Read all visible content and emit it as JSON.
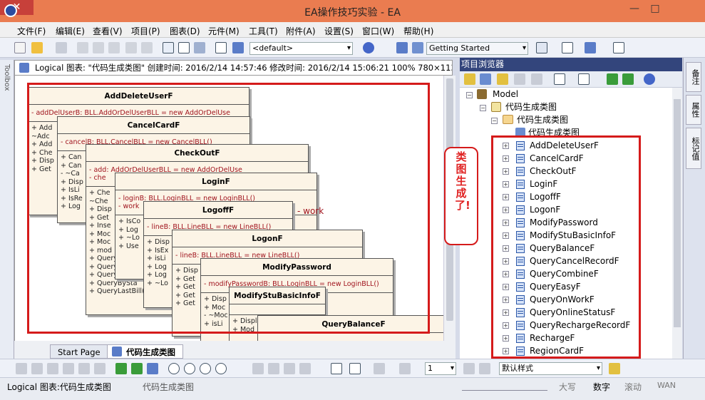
{
  "window": {
    "title": "EA操作技巧实验 - EA",
    "minimize": "—",
    "maximize": "□",
    "close": "✕"
  },
  "menu": [
    "文件(F)",
    "编辑(E)",
    "查看(V)",
    "项目(P)",
    "图表(D)",
    "元件(M)",
    "工具(T)",
    "附件(A)",
    "设置(S)",
    "窗口(W)",
    "帮助(H)"
  ],
  "toolbar": {
    "default_select": "<default>",
    "getting_started": "Getting Started"
  },
  "toolbox_label": "Toolbox",
  "diagram_header": "Logical 图表: \"代码生成类图\"  创建时间: 2016/2/14 14:57:46  修改时间: 2016/2/14 15:06:21  100%  780×1134",
  "classes": [
    {
      "name": "AddDeleteUserF",
      "attr": "-  addDelUserB:  BLL.AddOrDelUserBLL = new AddOrDelUse",
      "methods": [
        "+  Add",
        "~Adc",
        "+  Add",
        "+  Che",
        "+  Disp",
        "+  Get"
      ]
    },
    {
      "name": "CancelCardF",
      "attr": "-  cancelB:  BLL.CancelBLL = new CancelBLL()",
      "methods": [
        "+  Can",
        "+  Can",
        "-  ~Ca",
        "+  Disp",
        "+  IsLi",
        "+  IsRe",
        "+  Log"
      ]
    },
    {
      "name": "CheckOutF",
      "attr": "-  add:  AddOrDelUserBLL = new AddOrDelUse",
      "attr2": "-  che",
      "methods": [
        "+  Che",
        "~Che",
        "+  Disp",
        "+  Get",
        "+  Inse",
        "+  Moc",
        "+  Moc",
        "+  mod",
        "+  QueryBySta",
        "+  QueryBySta",
        "+  QueryBySta",
        "+  QueryBySta",
        "+  QueryLastBill() : List<"
      ]
    },
    {
      "name": "LoginF",
      "attr": "-  loginB:  BLL.LoginBLL = new LoginBLL()",
      "attr2": "-  work",
      "methods": [
        "+  IsCo",
        "+  Log",
        "+  ~Lo",
        "+  Use"
      ]
    },
    {
      "name": "LogoffF",
      "attr": "-  lineB:  BLL.LineBLL = new LineBLL()",
      "attr2": "eac...",
      "methods": [
        "+  Disp",
        "+  IsEx",
        "+  isLi",
        "+  Log",
        "+  Log",
        "+  ~Lo"
      ]
    },
    {
      "name": "LogonF",
      "attr": "-  lineB:  BLL.LineBLL = new LineBLL()",
      "methods": [
        "+  Disp",
        "+  Get",
        "+  Get",
        "+  Get",
        "+  Get",
        "+  Get"
      ]
    },
    {
      "name": "ModifyPassword",
      "attr": "-  modifyPasswordB:  BLL.LoginBLL = new LoginBLL()",
      "methods": [
        "+  Disp",
        "+  Moc",
        "-  ~Moc",
        "+  isLi"
      ]
    },
    {
      "name": "ModifyStuBasicInfoF",
      "attr": "",
      "methods": [
        "+  Displ",
        "+  Mod"
      ]
    },
    {
      "name": "QueryBalanceF",
      "attr": "",
      "methods": []
    }
  ],
  "tabs": {
    "start_page": "Start Page",
    "diagram_tab": "代码生成类图"
  },
  "project_browser": {
    "title": "项目浏览器",
    "model": "Model",
    "view": "代码生成类图",
    "package": "代码生成类图",
    "diagram": "代码生成类图",
    "classes": [
      "AddDeleteUserF",
      "CancelCardF",
      "CheckOutF",
      "LoginF",
      "LogoffF",
      "LogonF",
      "ModifyPassword",
      "ModifyStuBasicInfoF",
      "QueryBalanceF",
      "QueryCancelRecordF",
      "QueryCombineF",
      "QueryEasyF",
      "QueryOnWorkF",
      "QueryOnlineStatusF",
      "QueryRechargeRecordF",
      "RechargeF",
      "RegionCardF"
    ]
  },
  "right_tabs": [
    "备注",
    "属性",
    "标记值"
  ],
  "callout": "类图生成了!",
  "bottom_toolbar": {
    "font_size": "1",
    "style": "默认样式"
  },
  "status": {
    "left": "Logical 图表:代码生成类图",
    "mid": "代码生成类图",
    "caps": "大写",
    "num": "数字",
    "scroll": "滚动",
    "wan": "WAN"
  }
}
